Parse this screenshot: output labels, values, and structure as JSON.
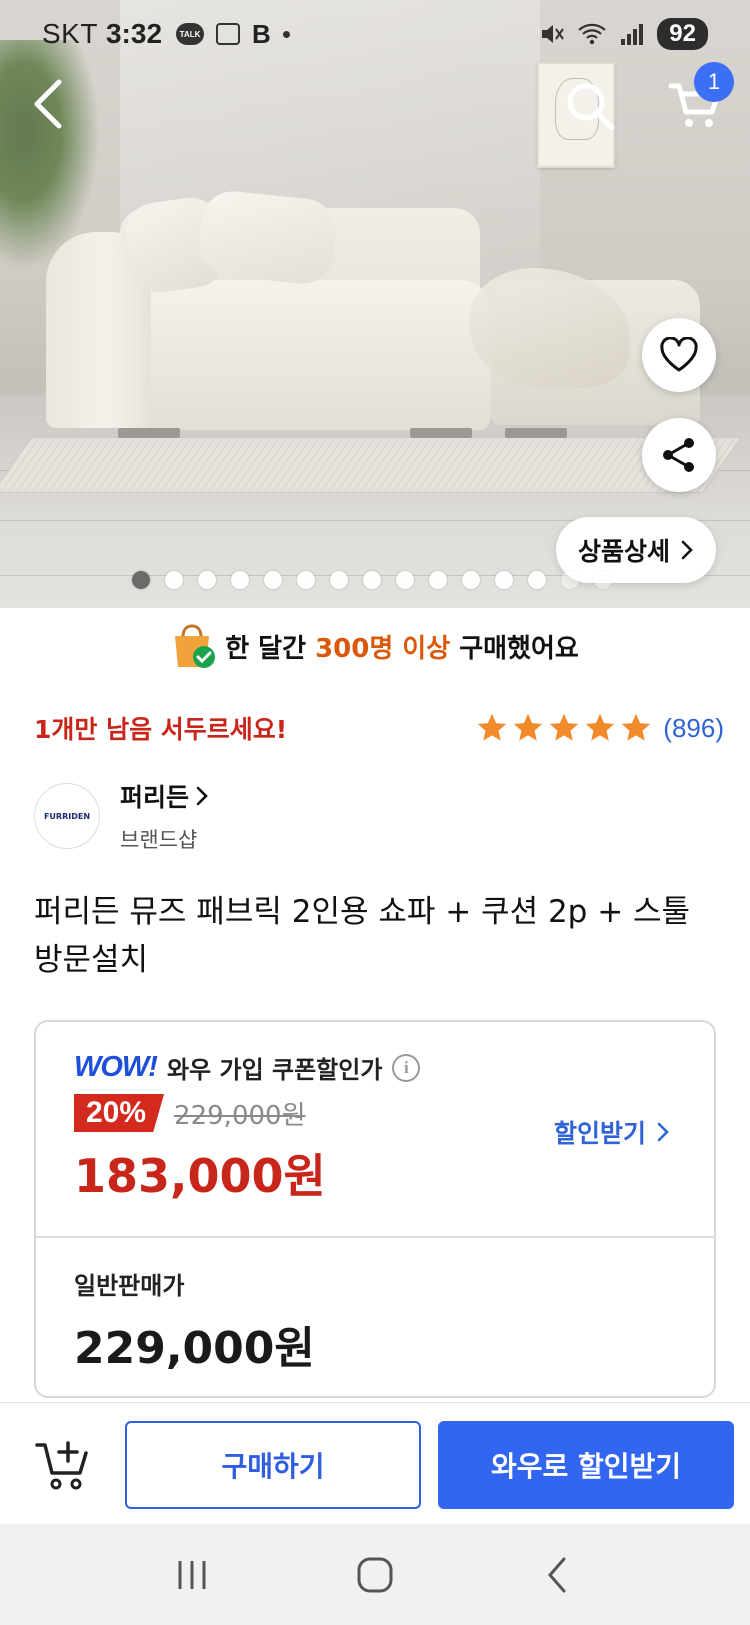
{
  "status_bar": {
    "carrier": "SKT",
    "time": "3:32",
    "talk_badge": "TALK",
    "b_icon": "B",
    "battery": "92"
  },
  "header": {
    "cart_count": "1",
    "icons": [
      "back-icon",
      "search-icon",
      "cart-icon"
    ]
  },
  "hero": {
    "detail_button": "상품상세",
    "image_count": 15,
    "active_image": 0
  },
  "purchase_banner": {
    "prefix": "한 달간 ",
    "highlight": "300명 이상",
    "suffix": " 구매했어요"
  },
  "stock_message": "1개만 남음 서두르세요!",
  "rating": {
    "stars": 5,
    "count": "(896)"
  },
  "brand": {
    "logo_text": "FURRIDEN",
    "name": "퍼리든",
    "subtitle": "브랜드샵"
  },
  "product": {
    "title": "퍼리든 뮤즈 패브릭 2인용 쇼파 + 쿠션 2p + 스툴 방문설치"
  },
  "price": {
    "wow_logo": "WOW!",
    "wow_label": "와우 가입 쿠폰할인가",
    "discount": "20%",
    "original_price": "229,000원",
    "sale_price": "183,000원",
    "coupon_link": "할인받기",
    "normal_label": "일반판매가",
    "normal_price": "229,000원"
  },
  "bottom_bar": {
    "buy_label": "구매하기",
    "wow_label": "와우로 할인받기"
  },
  "colors": {
    "accent_blue": "#3366f0",
    "link_blue": "#2f63d6",
    "sale_red": "#c8261b",
    "highlight_orange": "#d9580a",
    "star_orange": "#f08a2b"
  }
}
